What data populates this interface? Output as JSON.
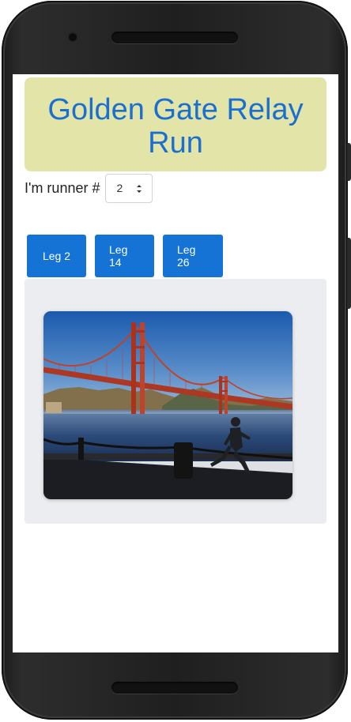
{
  "app": {
    "title": "Golden Gate Relay Run"
  },
  "runner": {
    "label": "I'm runner #",
    "selected_value": "2"
  },
  "legs": [
    {
      "label": "Leg 2"
    },
    {
      "label": "Leg 14"
    },
    {
      "label": "Leg 26"
    }
  ],
  "photo": {
    "subject": "golden-gate-bridge-runner-photo"
  },
  "colors": {
    "title_bg": "#e3e4a7",
    "title_text": "#1a6fd1",
    "button_bg": "#1573d6",
    "panel_bg": "#ebedf0"
  }
}
